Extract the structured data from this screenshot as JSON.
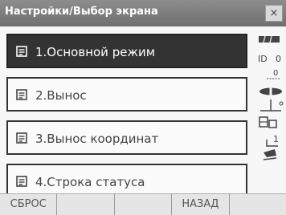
{
  "window": {
    "title": "Настройки/Выбор экрана",
    "close_glyph": "×"
  },
  "menu": {
    "items": [
      {
        "label": "1.Основной режим",
        "icon": "screen-icon",
        "selected": true
      },
      {
        "label": "2.Вынос",
        "icon": "screen-icon",
        "selected": false
      },
      {
        "label": "3.Вынос координат",
        "icon": "screen-icon",
        "selected": false
      },
      {
        "label": "4.Строка статуса",
        "icon": "screen-icon",
        "selected": false
      }
    ]
  },
  "status": {
    "distance_label_1": "0",
    "distance_label_2": "0",
    "prism_label": "0",
    "tilt_label": "1"
  },
  "softkeys": {
    "reset": "СБРОС",
    "key2": "",
    "key3": "",
    "back": "НАЗАД",
    "key5": ""
  },
  "colors": {
    "titlebar": "#7a7a7a",
    "selected": "#333333",
    "background": "#f7f7f7"
  }
}
